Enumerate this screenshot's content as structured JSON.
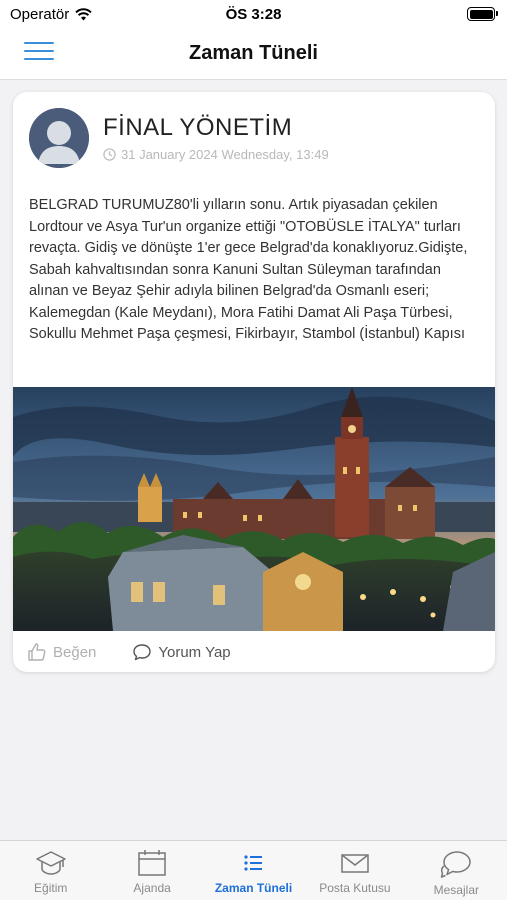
{
  "status_bar": {
    "carrier": "Operatör",
    "time": "ÖS 3:28"
  },
  "nav": {
    "title": "Zaman Tüneli",
    "menu_icon": "hamburger-menu-icon"
  },
  "post": {
    "author": "FİNAL YÖNETİM",
    "date": "31 January 2024 Wednesday, 13:49",
    "text": "BELGRAD TURUMUZ80'li yılların sonu. Artık piyasadan çekilen Lordtour ve Asya Tur'un organize ettiği \"OTOBÜSLE İTALYA\" turları revaçta. Gidiş ve dönüşte 1'er gece Belgrad'da konaklıyoruz.Gidişte, Sabah kahvaltısından sonra Kanuni Sultan Süleyman tarafından alınan ve Beyaz Şehir adıyla bilinen Belgrad'da Osmanlı eseri; Kalemegdan (Kale Meydanı), Mora Fatihi Damat Ali Paşa Türbesi, Sokullu Mehmet Paşa çeşmesi, Fikirbayır, Stambol (İstanbul) Kapısı",
    "like_label": "Beğen",
    "comment_label": "Yorum Yap"
  },
  "tabs": [
    {
      "label": "Eğitim",
      "icon": "graduation-cap-icon"
    },
    {
      "label": "Ajanda",
      "icon": "calendar-icon"
    },
    {
      "label": "Zaman Tüneli",
      "icon": "list-icon",
      "active": true
    },
    {
      "label": "Posta Kutusu",
      "icon": "envelope-icon"
    },
    {
      "label": "Mesajlar",
      "icon": "chat-bubbles-icon"
    }
  ],
  "colors": {
    "accent": "#1e6fd9",
    "menu": "#3a8fd9"
  }
}
